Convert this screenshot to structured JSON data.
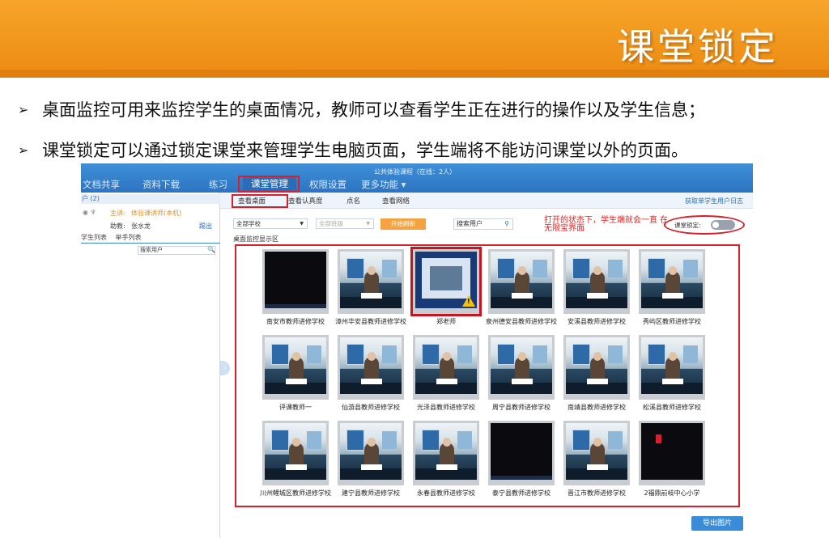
{
  "header": {
    "title": "课堂锁定"
  },
  "bullets": [
    "桌面监控可用来监控学生的桌面情况，教师可以查看学生正在进行的操作以及学生信息；",
    "课堂锁定可以通过锁定课堂来管理学生电脑页面，学生端将不能访问课堂以外的页面。"
  ],
  "bullet_marker": "➢",
  "app": {
    "live_status": "公共体验课程（在线：2人）",
    "nav": [
      "文档共享",
      "资料下载",
      "练习",
      "课堂管理",
      "权限设置",
      "更多功能 ▾"
    ],
    "sidebar": {
      "header": "户 (2)",
      "presenter_label": "主讲:",
      "presenter_name": "体验课讲师(本机)",
      "assistant_label": "助教:",
      "assistant_name": "张水龙",
      "assistant_action": "踢出",
      "tabs": [
        "学生列表",
        "举手列表"
      ],
      "search_placeholder": "搜索用户"
    },
    "tabs": [
      "查看桌面",
      "查看认真度",
      "点名",
      "查看网络"
    ],
    "log_link": "获取单学生用户日志",
    "school_select": "全部学校",
    "class_select": "全部班级",
    "refresh_button": "开始刷新",
    "search_placeholder": "搜索用户",
    "note": "打开的状态下，学生端就会一直 在无限宝界面",
    "lock_label": "课堂锁定:",
    "lock_enabled": false,
    "area_label": "桌面监控显示区",
    "thumbnails": [
      {
        "label": "南安市教师进修学校",
        "screen": "black"
      },
      {
        "label": "漳州华安县教师进修学校",
        "screen": "room"
      },
      {
        "label": "郑老师",
        "screen": "desk2"
      },
      {
        "label": "泉州德安县教师进修学校",
        "screen": "room"
      },
      {
        "label": "安溪县教师进修学校",
        "screen": "room"
      },
      {
        "label": "秀屿区教师进修学校",
        "screen": "room"
      },
      {
        "label": "评课教师一",
        "screen": "room"
      },
      {
        "label": "仙游县教师进修学校",
        "screen": "room"
      },
      {
        "label": "光泽县教师进修学校",
        "screen": "room"
      },
      {
        "label": "周宁县教师进修学校",
        "screen": "room"
      },
      {
        "label": "南靖县教师进修学校",
        "screen": "room"
      },
      {
        "label": "松溪县教师进修学校",
        "screen": "room"
      },
      {
        "label": "川州鲤城区教师进修学校",
        "screen": "room"
      },
      {
        "label": "建宁县教师进修学校",
        "screen": "room"
      },
      {
        "label": "永春县教师进修学校",
        "screen": "room"
      },
      {
        "label": "泰宁县教师进修学校",
        "screen": "black"
      },
      {
        "label": "晋江市教师进修学校",
        "screen": "room"
      },
      {
        "label": "2福鼎前岐中心小学",
        "screen": "small"
      }
    ],
    "export_button": "导出图片"
  },
  "colors": {
    "banner": "#f39a1f",
    "highlight": "#d7202b",
    "nav": "#2f7bcb"
  }
}
